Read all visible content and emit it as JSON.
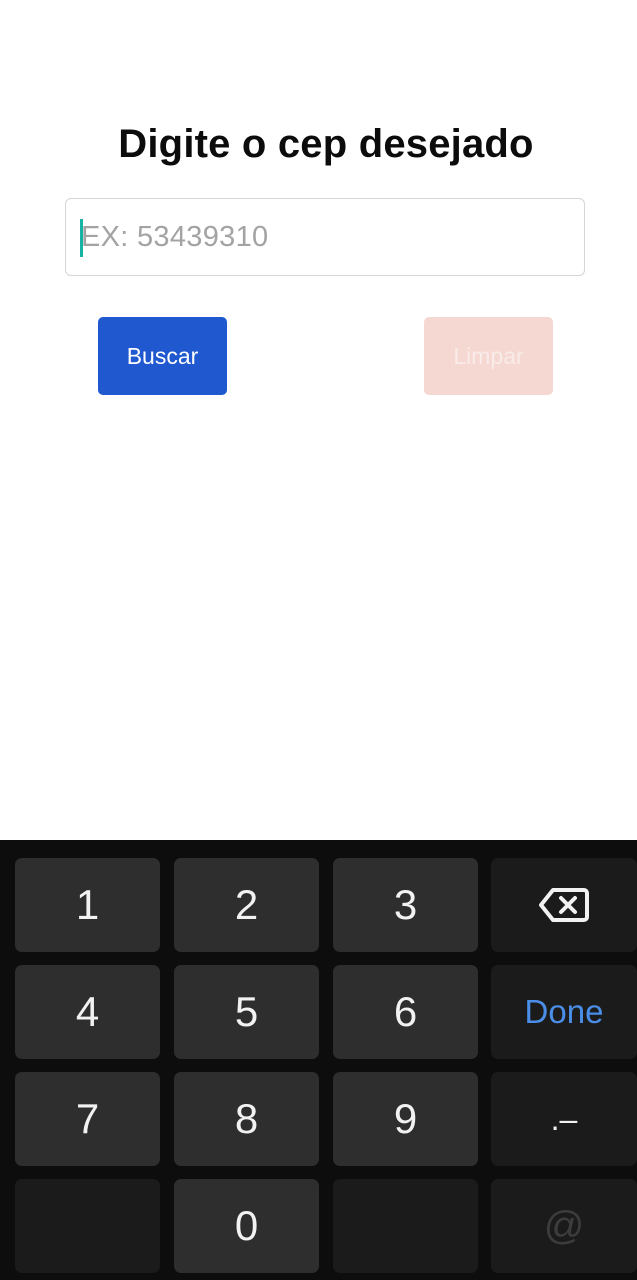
{
  "form": {
    "title": "Digite o cep desejado",
    "cep_placeholder": "EX: 53439310",
    "cep_value": "",
    "search_button_label": "Buscar",
    "clear_button_label": "Limpar"
  },
  "keyboard": {
    "keys": {
      "one": "1",
      "two": "2",
      "three": "3",
      "four": "4",
      "five": "5",
      "six": "6",
      "seven": "7",
      "eight": "8",
      "nine": "9",
      "zero": "0",
      "done": "Done",
      "symbols": ".–",
      "at": "@"
    },
    "backspace_icon": "backspace-icon"
  },
  "colors": {
    "primary_button": "#1f58cf",
    "clear_button_disabled": "#f6d8d3",
    "caret": "#16b3a3",
    "done_key": "#4a8ee8",
    "keyboard_bg": "#0d0d0d"
  }
}
